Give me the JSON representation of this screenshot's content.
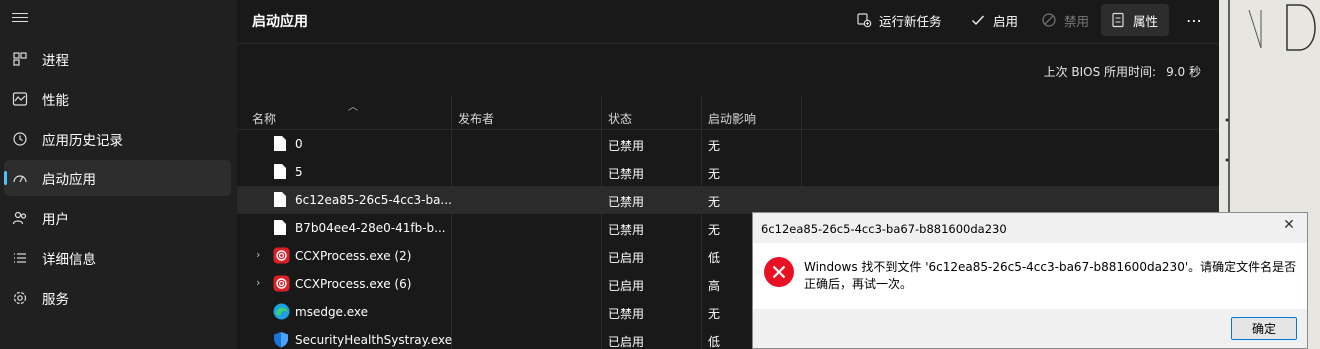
{
  "sidebar": {
    "items": [
      {
        "label": "进程",
        "icon": "processes-icon"
      },
      {
        "label": "性能",
        "icon": "performance-icon"
      },
      {
        "label": "应用历史记录",
        "icon": "history-icon"
      },
      {
        "label": "启动应用",
        "icon": "startup-icon",
        "active": true
      },
      {
        "label": "用户",
        "icon": "users-icon"
      },
      {
        "label": "详细信息",
        "icon": "details-icon"
      },
      {
        "label": "服务",
        "icon": "services-icon"
      }
    ]
  },
  "header": {
    "title": "启动应用",
    "toolbar": {
      "run_task": "运行新任务",
      "enable": "启用",
      "disable": "禁用",
      "properties": "属性",
      "more": "⋯"
    }
  },
  "bios": {
    "label": "上次 BIOS 所用时间:",
    "value": "9.0 秒"
  },
  "table": {
    "columns": [
      "名称",
      "发布者",
      "状态",
      "启动影响"
    ],
    "rows": [
      {
        "name": "0",
        "publisher": "",
        "status": "已禁用",
        "impact": "无",
        "icon": "file-icon"
      },
      {
        "name": "5",
        "publisher": "",
        "status": "已禁用",
        "impact": "无",
        "icon": "file-icon"
      },
      {
        "name": "6c12ea85-26c5-4cc3-ba...",
        "publisher": "",
        "status": "已禁用",
        "impact": "无",
        "icon": "file-icon"
      },
      {
        "name": "B7b04ee4-28e0-41fb-b...",
        "publisher": "",
        "status": "已禁用",
        "impact": "无",
        "icon": "file-icon"
      },
      {
        "name": "CCXProcess.exe (2)",
        "publisher": "",
        "status": "已启用",
        "impact": "低",
        "icon": "ccx-icon",
        "expandable": true
      },
      {
        "name": "CCXProcess.exe (6)",
        "publisher": "",
        "status": "已启用",
        "impact": "高",
        "icon": "ccx-icon",
        "expandable": true
      },
      {
        "name": "msedge.exe",
        "publisher": "",
        "status": "已禁用",
        "impact": "无",
        "icon": "edge-icon"
      },
      {
        "name": "SecurityHealthSystray.exe",
        "publisher": "",
        "status": "已启用",
        "impact": "低",
        "icon": "shield-icon"
      }
    ]
  },
  "dialog": {
    "title": "6c12ea85-26c5-4cc3-ba67-b881600da230",
    "message": "Windows 找不到文件 '6c12ea85-26c5-4cc3-ba67-b881600da230'。请确定文件名是否正确后，再试一次。",
    "ok_label": "确定",
    "close_label": "✕"
  },
  "colors": {
    "accent": "#4cc2ff",
    "error": "#e81123"
  }
}
